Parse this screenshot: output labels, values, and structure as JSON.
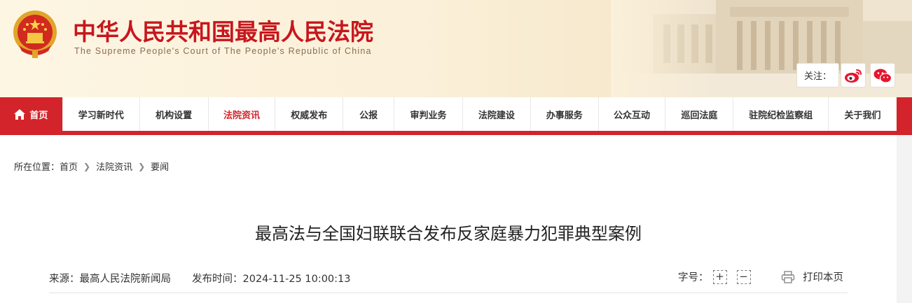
{
  "header": {
    "title": "中华人民共和国最高人民法院",
    "subtitle": "The Supreme People's Court of The People's Republic of China",
    "follow_label": "关注：",
    "emblem_icon": "national-emblem-icon",
    "social_icons": [
      "weibo-icon",
      "wechat-icon"
    ]
  },
  "nav": {
    "home": "首页",
    "items": [
      "学习新时代",
      "机构设置",
      "法院资讯",
      "权威发布",
      "公报",
      "审判业务",
      "法院建设",
      "办事服务",
      "公众互动",
      "巡回法庭",
      "驻院纪检监察组",
      "关于我们"
    ],
    "active": "法院资讯"
  },
  "breadcrumb": {
    "prefix": "所在位置：",
    "items": [
      "首页",
      "法院资讯",
      "要闻"
    ]
  },
  "article": {
    "title": "最高法与全国妇联联合发布反家庭暴力犯罪典型案例",
    "source": "来源：最高人民法院新闻局",
    "publish_time": "发布时间：2024-11-25 10:00:13",
    "font_size_label": "字号：",
    "font_plus": "+",
    "font_minus": "−",
    "print_label": "打印本页"
  },
  "colors": {
    "brand_red": "#d2242a",
    "title_red": "#c8161d",
    "header_bg": "#fbf0d9"
  }
}
